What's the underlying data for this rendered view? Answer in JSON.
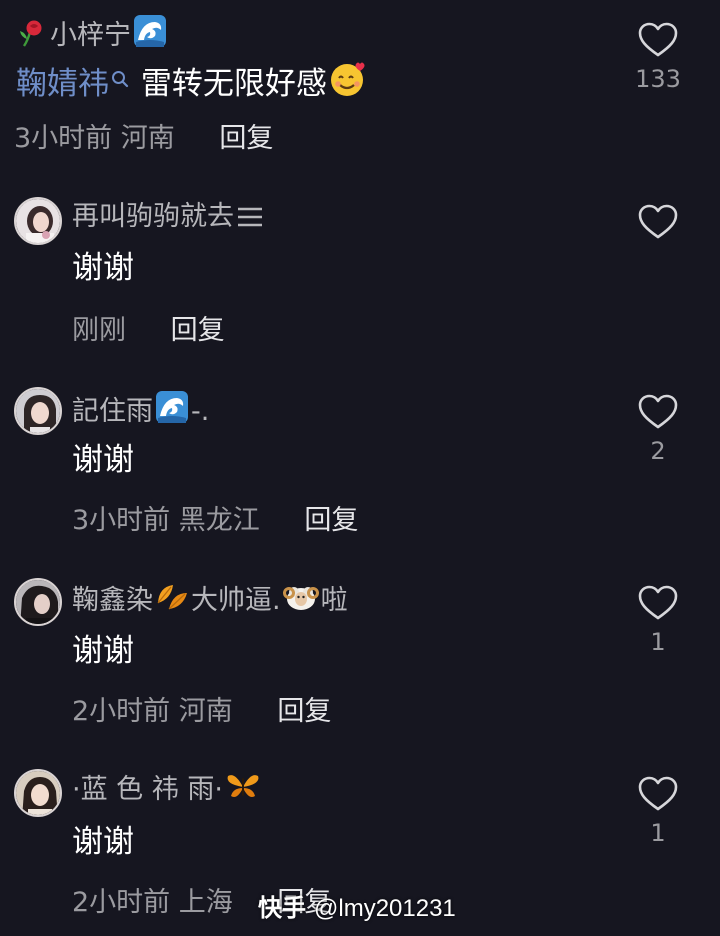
{
  "top_comment": {
    "username": "小梓宁",
    "mention": "鞠婧祎",
    "text": "雷转无限好感",
    "time": "3小时前",
    "location": "河南",
    "reply_label": "回复",
    "likes": "133"
  },
  "replies": [
    {
      "username": "再叫驹驹就去",
      "text": "谢谢",
      "time": "刚刚",
      "location": "",
      "reply_label": "回复",
      "likes": ""
    },
    {
      "username": "記住雨",
      "username_suffix": "-.",
      "text": "谢谢",
      "time": "3小时前",
      "location": "黑龙江",
      "reply_label": "回复",
      "likes": "2"
    },
    {
      "username": "鞠鑫染",
      "username_mid": "大帅逼.",
      "username_suffix": "啦",
      "text": "谢谢",
      "time": "2小时前",
      "location": "河南",
      "reply_label": "回复",
      "likes": "1"
    },
    {
      "username": "·蓝 色 祎 雨·",
      "text": "谢谢",
      "time": "2小时前",
      "location": "上海",
      "reply_label": "回复",
      "likes": "1"
    }
  ],
  "watermark": {
    "logo": "快手",
    "handle": "@lmy201231"
  },
  "colors": {
    "background": "#161620",
    "mention": "#6f8ec8",
    "muted": "#9b9ba0"
  }
}
